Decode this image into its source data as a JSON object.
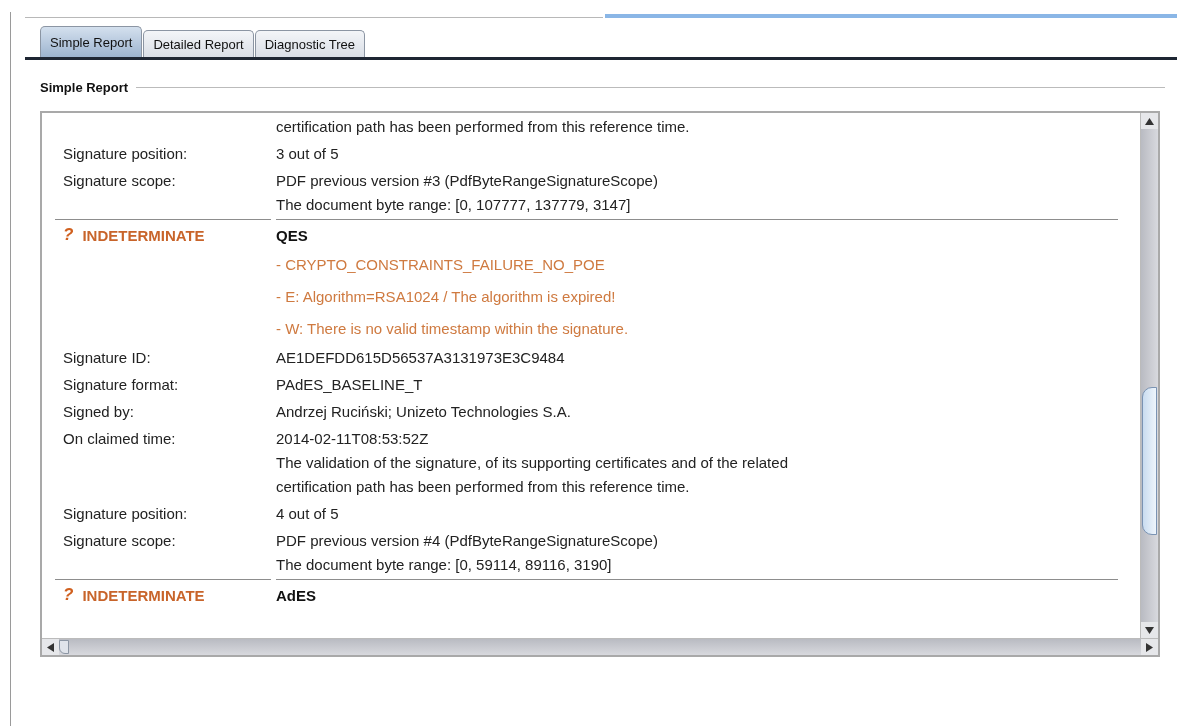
{
  "tabs": [
    {
      "label": "Simple Report",
      "selected": true
    },
    {
      "label": "Detailed Report",
      "selected": false
    },
    {
      "label": "Diagnostic Tree",
      "selected": false
    }
  ],
  "group_title": "Simple Report",
  "report": [
    {
      "kind": "field",
      "lines": [
        "certification path has been performed from this reference time."
      ]
    },
    {
      "kind": "field",
      "label": "Signature position:",
      "lines": [
        "3 out of 5"
      ]
    },
    {
      "kind": "field",
      "label": "Signature scope:",
      "lines": [
        "PDF previous version #3 (PdfByteRangeSignatureScope)",
        "The document byte range: [0, 107777, 137779, 3147]"
      ]
    },
    {
      "kind": "status",
      "icon": "?",
      "status": "INDETERMINATE",
      "level": "QES"
    },
    {
      "kind": "message",
      "text": "- CRYPTO_CONSTRAINTS_FAILURE_NO_POE"
    },
    {
      "kind": "message",
      "text": "- E: Algorithm=RSA1024 / The algorithm is expired!"
    },
    {
      "kind": "message",
      "text": "- W: There is no valid timestamp within the signature."
    },
    {
      "kind": "field",
      "label": "Signature ID:",
      "lines": [
        "AE1DEFDD615D56537A3131973E3C9484"
      ]
    },
    {
      "kind": "field",
      "label": "Signature format:",
      "lines": [
        "PAdES_BASELINE_T"
      ]
    },
    {
      "kind": "field",
      "label": "Signed by:",
      "lines": [
        "Andrzej Ruciński; Unizeto Technologies S.A."
      ]
    },
    {
      "kind": "field",
      "label": "On claimed time:",
      "lines": [
        "2014-02-11T08:53:52Z",
        "The validation of the signature, of its supporting certificates and of the related",
        "certification path has been performed from this reference time."
      ]
    },
    {
      "kind": "field",
      "label": "Signature position:",
      "lines": [
        "4 out of 5"
      ]
    },
    {
      "kind": "field",
      "label": "Signature scope:",
      "lines": [
        "PDF previous version #4 (PdfByteRangeSignatureScope)",
        "The document byte range: [0, 59114, 89116, 3190]"
      ]
    },
    {
      "kind": "status",
      "icon": "?",
      "status": "INDETERMINATE",
      "level": "AdES"
    }
  ]
}
